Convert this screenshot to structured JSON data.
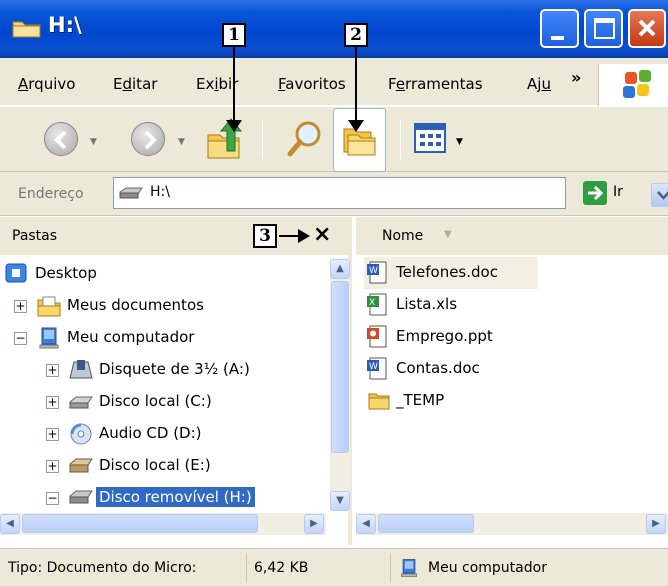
{
  "window": {
    "title": "H:\\"
  },
  "menu": {
    "items": [
      {
        "label": "Arquivo",
        "mnemonic": "A",
        "rest": "rquivo"
      },
      {
        "label": "Editar",
        "pre": "E",
        "mnemonic": "d",
        "rest": "itar"
      },
      {
        "label": "Exibir",
        "pre": "Ex",
        "mnemonic": "i",
        "rest": "bir"
      },
      {
        "label": "Favoritos",
        "mnemonic": "F",
        "rest": "avoritos"
      },
      {
        "label": "Ferramentas",
        "pre": "F",
        "mnemonic": "e",
        "rest": "rramentas"
      },
      {
        "label": "Aju",
        "pre": "Aj",
        "mnemonic": "u",
        "rest": ""
      }
    ],
    "more": "»"
  },
  "toolbar": {
    "buttons": [
      "back-icon",
      "forward-icon",
      "up-folder-icon",
      "search-icon",
      "folders-icon",
      "views-icon"
    ]
  },
  "address": {
    "label": "Endereço",
    "value": "H:\\",
    "go_label": "Ir"
  },
  "folders": {
    "title": "Pastas",
    "close": "×",
    "tree": [
      {
        "label": "Desktop",
        "icon": "desktop-icon",
        "expander": ""
      },
      {
        "label": "Meus documentos",
        "icon": "my-documents-icon",
        "expander": "+"
      },
      {
        "label": "Meu computador",
        "icon": "my-computer-icon",
        "expander": "−"
      },
      {
        "label": "Disquete de 3½ (A:)",
        "icon": "floppy-icon",
        "expander": "+"
      },
      {
        "label": "Disco local (C:)",
        "icon": "hard-drive-icon",
        "expander": "+"
      },
      {
        "label": "Audio CD (D:)",
        "icon": "cd-icon",
        "expander": "+"
      },
      {
        "label": "Disco local (E:)",
        "icon": "hard-drive-icon",
        "expander": "+"
      },
      {
        "label": "Disco removível (H:)",
        "icon": "removable-drive-icon",
        "expander": "−",
        "selected": true
      }
    ]
  },
  "files": {
    "column": "Nome",
    "items": [
      {
        "name": "Telefones.doc",
        "icon": "word-doc-icon"
      },
      {
        "name": "Lista.xls",
        "icon": "excel-xls-icon"
      },
      {
        "name": "Emprego.ppt",
        "icon": "powerpoint-ppt-icon"
      },
      {
        "name": "Contas.doc",
        "icon": "word-doc-icon"
      },
      {
        "name": "_TEMP",
        "icon": "folder-icon"
      }
    ]
  },
  "status": {
    "type": "Tipo: Documento do Micro:",
    "size": "6,42 KB",
    "location": "Meu computador"
  },
  "callouts": [
    "1",
    "2",
    "3"
  ],
  "colors": {
    "titlebar": "#0a56d8",
    "selection": "#316ac5",
    "chrome": "#ece9d8",
    "go": "#2f9e3f"
  }
}
